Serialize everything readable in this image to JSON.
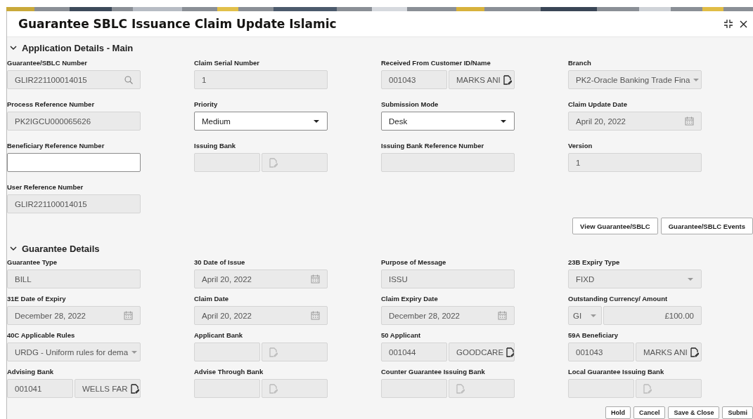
{
  "window": {
    "title": "Guarantee SBLC Issuance Claim Update Islamic"
  },
  "sections": [
    {
      "title": "Application Details - Main",
      "expanded": true,
      "fields": [
        {
          "label": "Guarantee/SBLC Number",
          "kind": "search",
          "value": "GLIR221100014015",
          "disabled": true
        },
        {
          "label": "Claim Serial Number",
          "kind": "text",
          "value": "1",
          "disabled": true
        },
        {
          "label": "Received From Customer ID/Name",
          "kind": "lookup",
          "value": "001043",
          "name": "MARKS ANI",
          "disabled": true
        },
        {
          "label": "Branch",
          "kind": "select",
          "value": "PK2-Oracle Banking Trade Fina",
          "disabled": true
        },
        {
          "label": "Process Reference Number",
          "kind": "text",
          "value": "PK2IGCU000065626",
          "disabled": true
        },
        {
          "label": "Priority",
          "kind": "select",
          "value": "Medium",
          "disabled": false
        },
        {
          "label": "Submission Mode",
          "kind": "select",
          "value": "Desk",
          "disabled": false
        },
        {
          "label": "Claim Update Date",
          "kind": "date",
          "value": "April 20, 2022",
          "disabled": true
        },
        {
          "label": "Beneficiary Reference Number",
          "kind": "text",
          "disabled": false
        },
        {
          "label": "Issuing Bank",
          "kind": "lookup",
          "disabled": true
        },
        {
          "label": "Issuing Bank Reference Number",
          "kind": "text",
          "disabled": true
        },
        {
          "label": "Version",
          "kind": "text",
          "value": "1",
          "disabled": true
        },
        {
          "label": "User Reference Number",
          "kind": "text",
          "value": "GLIR221100014015",
          "disabled": true
        }
      ],
      "buttons": [
        "View Guarantee/SBLC",
        "Guarantee/SBLC Events"
      ]
    },
    {
      "title": "Guarantee Details",
      "expanded": true,
      "fields": [
        {
          "label": "Guarantee Type",
          "kind": "text",
          "value": "BILL",
          "disabled": true
        },
        {
          "label": "30 Date of Issue",
          "kind": "date",
          "value": "April 20, 2022",
          "disabled": true
        },
        {
          "label": "Purpose of Message",
          "kind": "text",
          "value": "ISSU",
          "disabled": true
        },
        {
          "label": "23B Expiry Type",
          "kind": "select",
          "value": "FIXD",
          "disabled": true
        },
        {
          "label": "31E Date of Expiry",
          "kind": "date",
          "value": "December 28, 2022",
          "disabled": true
        },
        {
          "label": "Claim Date",
          "kind": "date",
          "value": "April 20, 2022",
          "disabled": true
        },
        {
          "label": "Claim Expiry Date",
          "kind": "date",
          "value": "December 28, 2022",
          "disabled": true
        },
        {
          "label": "Outstanding Currency/ Amount",
          "kind": "amount",
          "currency": "GI",
          "value": "£100.00",
          "disabled": true
        },
        {
          "label": "40C Applicable Rules",
          "kind": "select",
          "value": "URDG - Uniform rules for dema",
          "disabled": true
        },
        {
          "label": "Applicant Bank",
          "kind": "lookup",
          "disabled": true
        },
        {
          "label": "50 Applicant",
          "kind": "lookup",
          "value": "001044",
          "name": "GOODCARE",
          "disabled": true
        },
        {
          "label": "59A Beneficiary",
          "kind": "lookup",
          "value": "001043",
          "name": "MARKS ANI",
          "disabled": true
        },
        {
          "label": "Advising Bank",
          "kind": "lookup",
          "value": "001041",
          "name": "WELLS FAR",
          "disabled": true
        },
        {
          "label": "Advise Through Bank",
          "kind": "lookup",
          "disabled": true
        },
        {
          "label": "Counter Guarantee Issuing Bank",
          "kind": "lookup",
          "disabled": true
        },
        {
          "label": "Local Guarantee Issuing Bank",
          "kind": "lookup",
          "disabled": true
        }
      ]
    }
  ],
  "footer_buttons": [
    "Hold",
    "Cancel",
    "Save & Close",
    "Submi"
  ]
}
